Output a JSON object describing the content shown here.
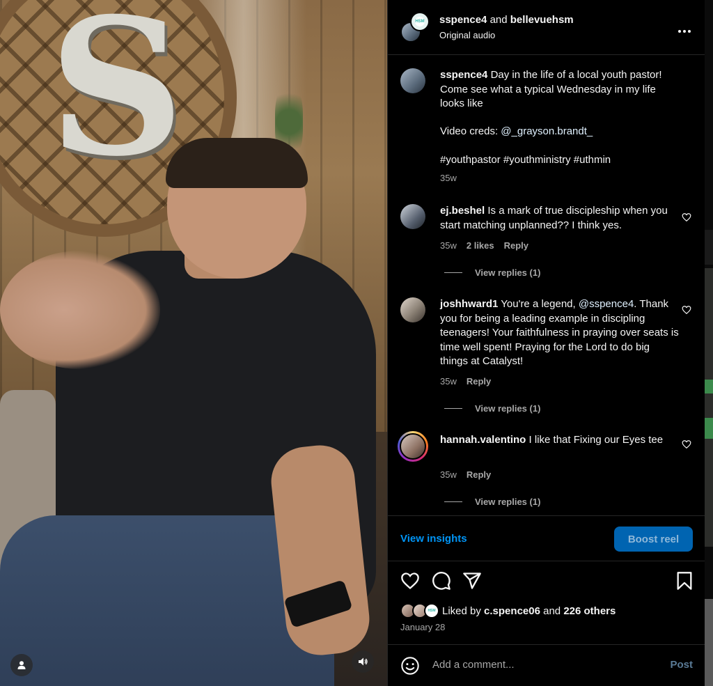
{
  "header": {
    "user1": "sspence4",
    "conjunction": "and",
    "user2": "bellevuehsm",
    "audio": "Original audio",
    "more_icon": "more-horizontal-icon",
    "collab_badge": "HSM"
  },
  "caption": {
    "username": "sspence4",
    "text": "Day in the life of a local youth pastor! Come see what a typical Wednesday in my life looks like",
    "creds_label": "Video creds:",
    "creds_mention": "@_grayson.brandt_",
    "hashtags": "#youthpastor #youthministry #uthmin",
    "time": "35w"
  },
  "comments": [
    {
      "username": "ej.beshel",
      "text": "Is a mark of true discipleship when you start matching unplanned?? I think yes.",
      "time": "35w",
      "likes": "2 likes",
      "reply": "Reply",
      "view_replies": "View replies (1)"
    },
    {
      "username": "joshhward1",
      "text_before": "You're a legend,",
      "mention": "@sspence4",
      "text_after": ". Thank you for being a leading example in discipling teenagers! Your faithfulness in praying over seats is time well spent! Praying for the Lord to do big things at Catalyst!",
      "time": "35w",
      "reply": "Reply",
      "view_replies": "View replies (1)"
    },
    {
      "username": "hannah.valentino",
      "text": "I like that Fixing our Eyes tee",
      "time": "35w",
      "reply": "Reply",
      "view_replies": "View replies (1)"
    }
  ],
  "insights": {
    "view_label": "View insights",
    "boost_label": "Boost reel"
  },
  "actions": {
    "icons": [
      "heart-icon",
      "comment-icon",
      "share-icon",
      "bookmark-icon"
    ]
  },
  "likes": {
    "prefix": "Liked by",
    "user": "c.spence06",
    "and": "and",
    "others": "226 others",
    "date": "January 28"
  },
  "comment_box": {
    "placeholder": "Add a comment...",
    "post_label": "Post"
  },
  "video": {
    "icons": [
      "user-profile-icon",
      "speaker-icon"
    ]
  },
  "colors": {
    "link_blue": "#0095f6",
    "boost_bg": "#0064b1",
    "muted_text": "#a8a8a8",
    "background": "#000000"
  }
}
